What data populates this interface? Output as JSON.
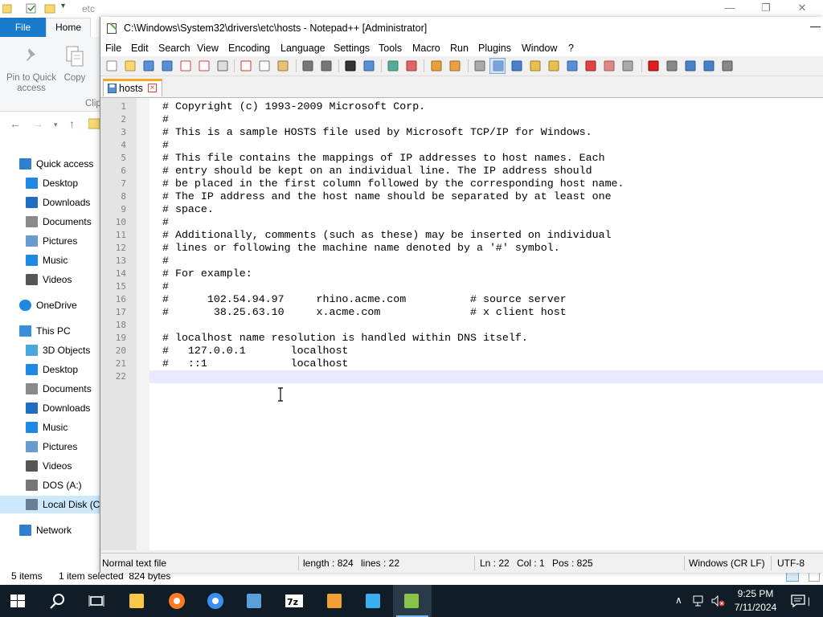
{
  "explorer": {
    "title": "etc",
    "ribbon_tabs": [
      "File",
      "Home"
    ],
    "ribbon_buttons": [
      "Pin to Quick access",
      "Copy",
      "Clip"
    ],
    "nav": [
      {
        "label": "Quick access",
        "icon": "star-icon",
        "level": 0
      },
      {
        "label": "Desktop",
        "icon": "desktop-folder-icon",
        "level": 1
      },
      {
        "label": "Downloads",
        "icon": "downloads-folder-icon",
        "level": 1
      },
      {
        "label": "Documents",
        "icon": "documents-folder-icon",
        "level": 1
      },
      {
        "label": "Pictures",
        "icon": "pictures-folder-icon",
        "level": 1
      },
      {
        "label": "Music",
        "icon": "music-folder-icon",
        "level": 1
      },
      {
        "label": "Videos",
        "icon": "videos-folder-icon",
        "level": 1
      },
      {
        "label": "OneDrive",
        "icon": "cloud-icon",
        "level": 0
      },
      {
        "label": "This PC",
        "icon": "computer-icon",
        "level": 0
      },
      {
        "label": "3D Objects",
        "icon": "3d-objects-icon",
        "level": 1
      },
      {
        "label": "Desktop",
        "icon": "desktop-folder-icon",
        "level": 1
      },
      {
        "label": "Documents",
        "icon": "documents-folder-icon",
        "level": 1
      },
      {
        "label": "Downloads",
        "icon": "downloads-folder-icon",
        "level": 1
      },
      {
        "label": "Music",
        "icon": "music-folder-icon",
        "level": 1
      },
      {
        "label": "Pictures",
        "icon": "pictures-folder-icon",
        "level": 1
      },
      {
        "label": "Videos",
        "icon": "videos-folder-icon",
        "level": 1
      },
      {
        "label": "DOS (A:)",
        "icon": "drive-icon",
        "level": 1
      },
      {
        "label": "Local Disk (C:)",
        "icon": "local-disk-icon",
        "level": 1,
        "selected": true
      },
      {
        "label": "Network",
        "icon": "network-icon",
        "level": 0
      }
    ],
    "status": {
      "items": "5 items",
      "selected": "1 item selected  824 bytes"
    }
  },
  "npp": {
    "title": "C:\\Windows\\System32\\drivers\\etc\\hosts - Notepad++ [Administrator]",
    "menu": [
      "File",
      "Edit",
      "Search",
      "View",
      "Encoding",
      "Language",
      "Settings",
      "Tools",
      "Macro",
      "Run",
      "Plugins",
      "Window",
      "?"
    ],
    "tab": {
      "label": "hosts",
      "close": "×"
    },
    "lines": [
      "# Copyright (c) 1993-2009 Microsoft Corp.",
      "#",
      "# This is a sample HOSTS file used by Microsoft TCP/IP for Windows.",
      "#",
      "# This file contains the mappings of IP addresses to host names. Each",
      "# entry should be kept on an individual line. The IP address should",
      "# be placed in the first column followed by the corresponding host name.",
      "# The IP address and the host name should be separated by at least one",
      "# space.",
      "#",
      "# Additionally, comments (such as these) may be inserted on individual",
      "# lines or following the machine name denoted by a '#' symbol.",
      "#",
      "# For example:",
      "#",
      "#      102.54.94.97     rhino.acme.com          # source server",
      "#       38.25.63.10     x.acme.com              # x client host",
      "",
      "# localhost name resolution is handled within DNS itself.",
      "#   127.0.0.1       localhost",
      "#   ::1             localhost",
      ""
    ],
    "status": {
      "type": "Normal text file",
      "length": "length : 824",
      "lines": "lines : 22",
      "ln": "Ln : 22",
      "col": "Col : 1",
      "pos": "Pos : 825",
      "eol": "Windows (CR LF)",
      "encoding": "UTF-8"
    }
  },
  "taskbar": {
    "time": "9:25 PM",
    "date": "7/11/2024",
    "apps": [
      "start-icon",
      "search-icon",
      "task-view-icon",
      "file-explorer-icon",
      "firefox-icon",
      "chrome-icon",
      "virtualbox-icon",
      "7zip-icon",
      "paint-icon",
      "install-icon",
      "notepadpp-icon"
    ]
  },
  "colors": {
    "accent": "#1979ca",
    "taskbar": "#101c26",
    "gutter": "#e4e4e4",
    "caret_line": "#e8e8ff"
  }
}
